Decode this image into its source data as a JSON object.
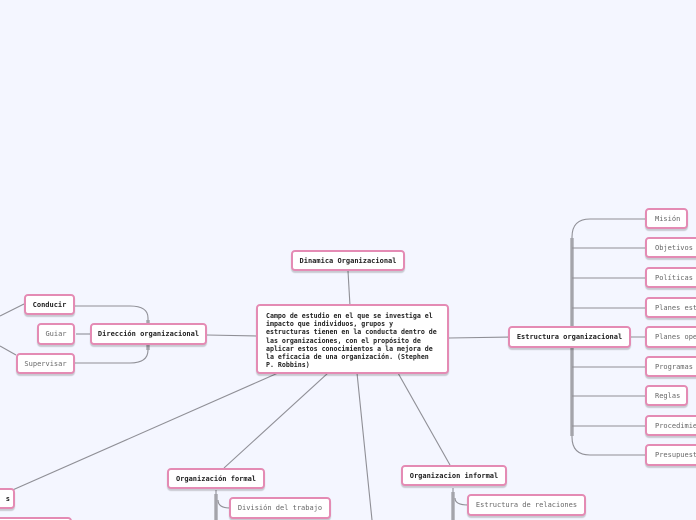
{
  "title": "Dinamica Organizacional",
  "central": "Campo de estudio en el que se investiga el impacto que individuos, grupos y estructuras tienen en la conducta dentro de las organizaciones, con el propósito de aplicar estos conocimientos a la mejora de la eficacia de una organización. (Stephen P. Robbins)",
  "direccion": {
    "label": "Dirección organizacional",
    "children": [
      "Conducir",
      "Guiar",
      "Supervisar"
    ]
  },
  "estructura": {
    "label": "Estructura organizacional",
    "children": [
      "Misión",
      "Objetivos",
      "Políticas",
      "Planes est",
      "Planes ope",
      "Programas",
      "Reglas",
      "Procedimie",
      "Presupuest"
    ]
  },
  "formal": {
    "label": "Organización formal",
    "children": [
      "División del trabajo"
    ]
  },
  "informal": {
    "label": "Organizacion informal",
    "children": [
      "Estructura de relaciones"
    ]
  },
  "left_partial": "s"
}
